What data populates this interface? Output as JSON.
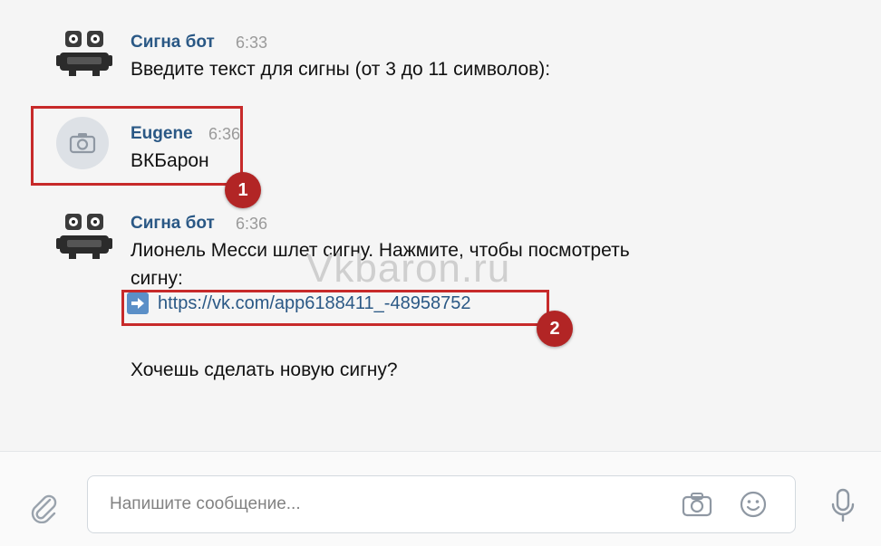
{
  "messages": [
    {
      "sender": "Сигна бот",
      "time": "6:33",
      "text": "Введите текст для сигны (от 3 до 11 символов):",
      "avatar_icon": "robot-icon"
    },
    {
      "sender": "Eugene",
      "time": "6:36",
      "text": "ВКБарон",
      "avatar_icon": "camera-icon",
      "badge": "1"
    },
    {
      "sender": "Сигна бот",
      "time": "6:36",
      "text_line1": "Лионель Месси шлет сигну. Нажмите, чтобы посмотреть",
      "text_line2": "сигну:",
      "link": "https://vk.com/app6188411_-48958752",
      "link_icon": "arrow-right-icon",
      "badge": "2",
      "followup": "Хочешь сделать новую сигну?",
      "avatar_icon": "robot-icon"
    }
  ],
  "watermark": "Vkbaron.ru",
  "composer": {
    "placeholder": "Напишите сообщение...",
    "icons": [
      "paperclip-icon",
      "camera-icon",
      "emoji-icon",
      "microphone-icon"
    ]
  },
  "colors": {
    "highlight": "#c72a2a",
    "badge": "#b22525",
    "name": "#2a5885",
    "link": "#2a5885"
  }
}
